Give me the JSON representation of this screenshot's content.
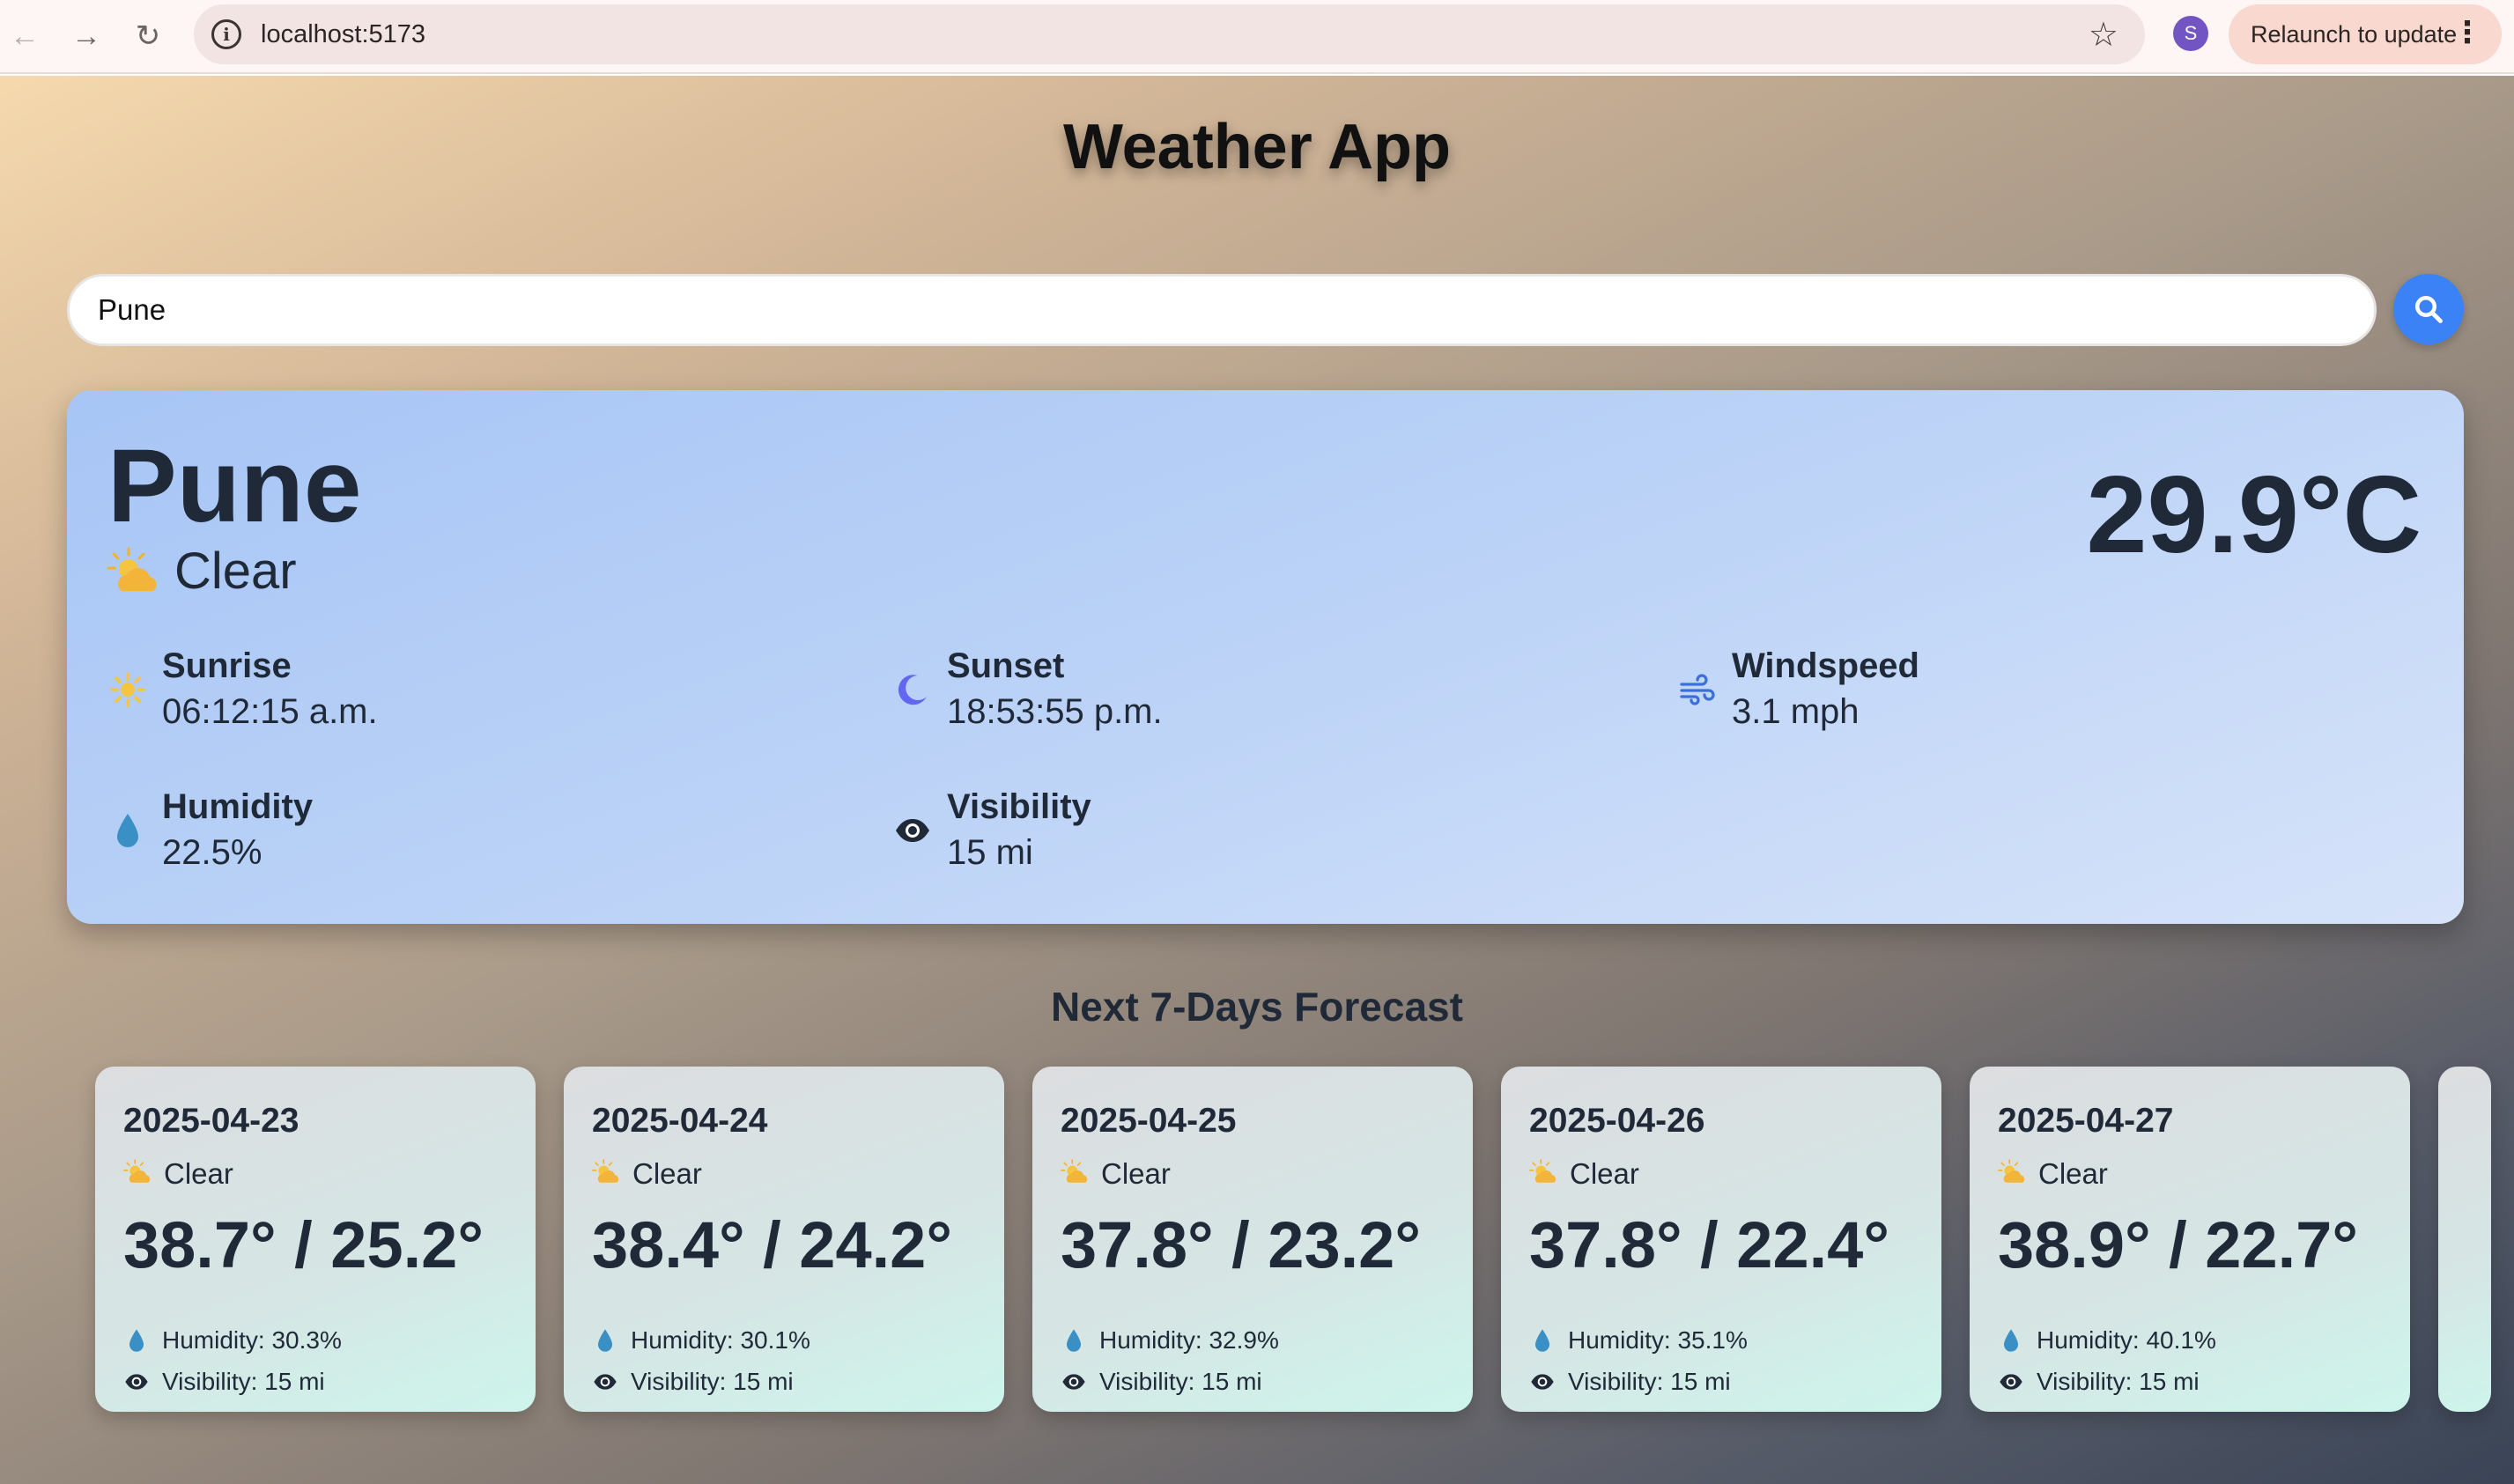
{
  "browser": {
    "url": "localhost:5173",
    "profile_initial": "S",
    "relaunch_label": "Relaunch to update"
  },
  "app": {
    "title": "Weather App"
  },
  "search": {
    "value": "Pune"
  },
  "current": {
    "city": "Pune",
    "condition": "Clear",
    "temperature": "29.9°C",
    "metrics": [
      {
        "label": "Sunrise",
        "value": "06:12:15 a.m.",
        "icon": "sun-icon"
      },
      {
        "label": "Sunset",
        "value": "18:53:55 p.m.",
        "icon": "moon-icon"
      },
      {
        "label": "Windspeed",
        "value": "3.1 mph",
        "icon": "wind-icon"
      },
      {
        "label": "Humidity",
        "value": "22.5%",
        "icon": "droplet-icon"
      },
      {
        "label": "Visibility",
        "value": "15 mi",
        "icon": "eye-icon"
      }
    ]
  },
  "forecast": {
    "title": "Next 7-Days Forecast",
    "days": [
      {
        "date": "2025-04-23",
        "condition": "Clear",
        "temps": "38.7° / 25.2°",
        "humidity": "Humidity: 30.3%",
        "visibility": "Visibility: 15 mi"
      },
      {
        "date": "2025-04-24",
        "condition": "Clear",
        "temps": "38.4° / 24.2°",
        "humidity": "Humidity: 30.1%",
        "visibility": "Visibility: 15 mi"
      },
      {
        "date": "2025-04-25",
        "condition": "Clear",
        "temps": "37.8° / 23.2°",
        "humidity": "Humidity: 32.9%",
        "visibility": "Visibility: 15 mi"
      },
      {
        "date": "2025-04-26",
        "condition": "Clear",
        "temps": "37.8° / 22.4°",
        "humidity": "Humidity: 35.1%",
        "visibility": "Visibility: 15 mi"
      },
      {
        "date": "2025-04-27",
        "condition": "Clear",
        "temps": "38.9° / 22.7°",
        "humidity": "Humidity: 40.1%",
        "visibility": "Visibility: 15 mi"
      }
    ]
  },
  "colors": {
    "accent": "#3b82f6",
    "sun": "#f5c542",
    "moon": "#6366f1",
    "wind": "#3b6fd8",
    "droplet": "#3a8fc4"
  }
}
